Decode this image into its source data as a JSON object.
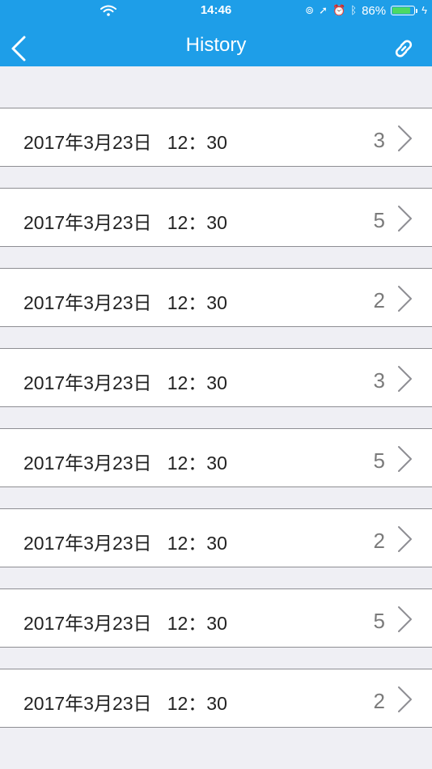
{
  "status_bar": {
    "time": "14:46",
    "battery_percent": "86%",
    "battery_level": 0.86,
    "icons": [
      "wifi-icon",
      "lock-rotation-icon",
      "location-arrow-icon",
      "alarm-icon",
      "bluetooth-icon",
      "battery-icon",
      "charging-bolt-icon"
    ]
  },
  "nav": {
    "title": "History",
    "back_icon": "chevron-left-icon",
    "action_icon": "link-icon"
  },
  "colors": {
    "nav_background": "#1e9ee8",
    "page_background": "#efeff4",
    "row_background": "#ffffff",
    "count_text": "#7b7b7b",
    "battery_fill": "#4cd964"
  },
  "history": {
    "items": [
      {
        "datetime": "2017年3月23日   12：30",
        "count": "3"
      },
      {
        "datetime": "2017年3月23日   12：30",
        "count": "5"
      },
      {
        "datetime": "2017年3月23日   12：30",
        "count": "2"
      },
      {
        "datetime": "2017年3月23日   12：30",
        "count": "3"
      },
      {
        "datetime": "2017年3月23日   12：30",
        "count": "5"
      },
      {
        "datetime": "2017年3月23日   12：30",
        "count": "2"
      },
      {
        "datetime": "2017年3月23日   12：30",
        "count": "5"
      },
      {
        "datetime": "2017年3月23日   12：30",
        "count": "2"
      }
    ]
  }
}
